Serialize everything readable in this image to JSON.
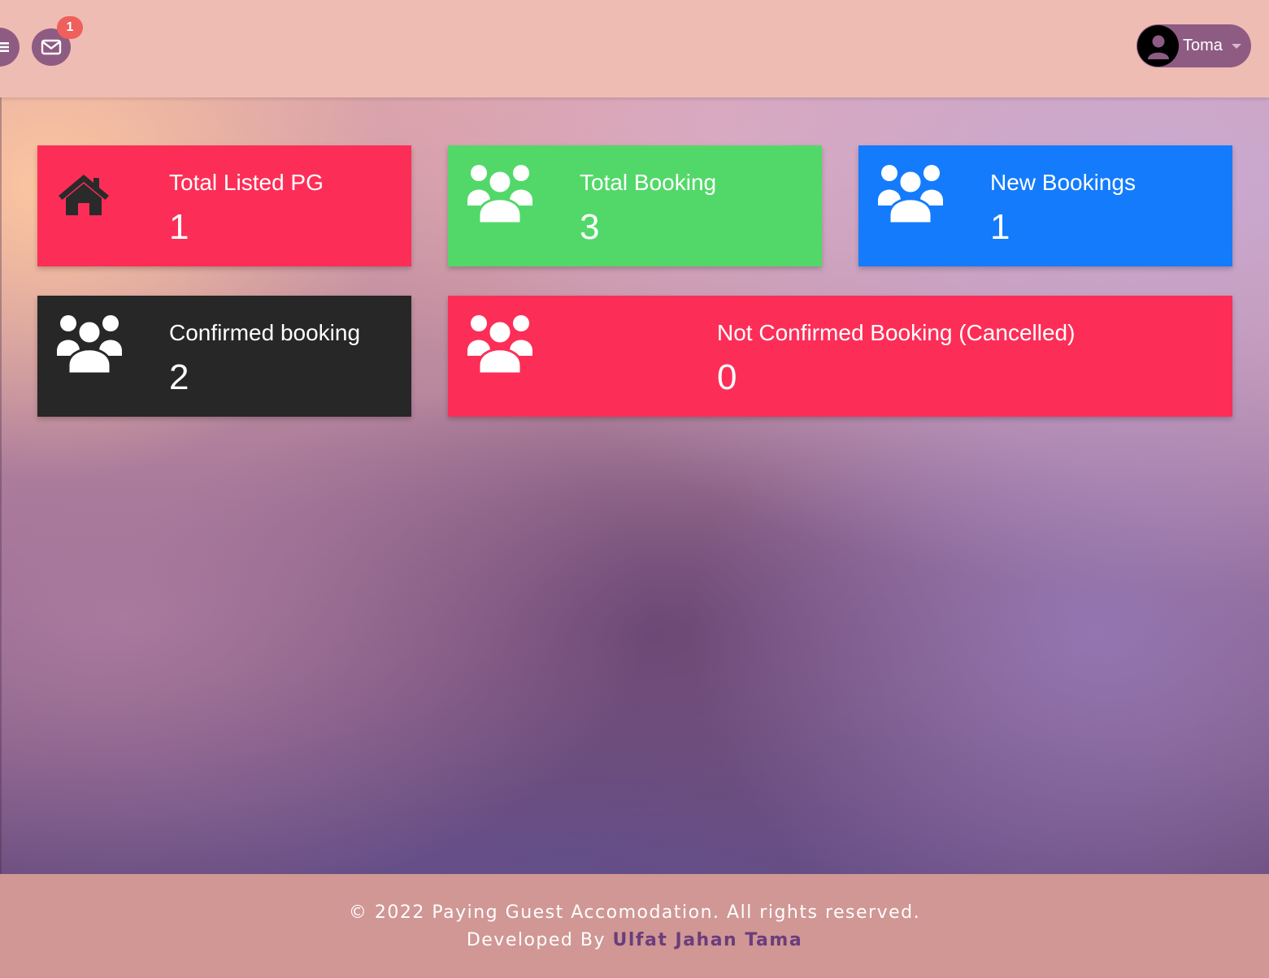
{
  "header": {
    "menu_icon": "hamburger-icon",
    "mail_icon": "envelope-icon",
    "notification_count": "1",
    "user_name": "Toma",
    "user_avatar_icon": "user-silhouette-icon"
  },
  "cards": [
    {
      "label": "Total Listed PG",
      "value": "1",
      "icon": "home-icon",
      "color": "#fc2e57"
    },
    {
      "label": "Total Booking",
      "value": "3",
      "icon": "users-icon",
      "color": "#52d869"
    },
    {
      "label": "New Bookings",
      "value": "1",
      "icon": "users-icon",
      "color": "#147bfc"
    },
    {
      "label": "Confirmed booking",
      "value": "2",
      "icon": "users-icon",
      "color": "#272727"
    },
    {
      "label": "Not Confirmed Booking (Cancelled)",
      "value": "0",
      "icon": "users-icon",
      "color": "#fc2e57"
    }
  ],
  "footer": {
    "copyright": "© 2022 Paying Guest Accomodation. All rights reserved.",
    "developed_by": "Developed By",
    "developer_name": "Ulfat Jahan Tama"
  },
  "colors": {
    "topbar": "#efbcb4",
    "button": "#8e5b83",
    "badge": "#ef5f5c",
    "footer": "#d09794",
    "developer_link": "#6a3d7d"
  }
}
